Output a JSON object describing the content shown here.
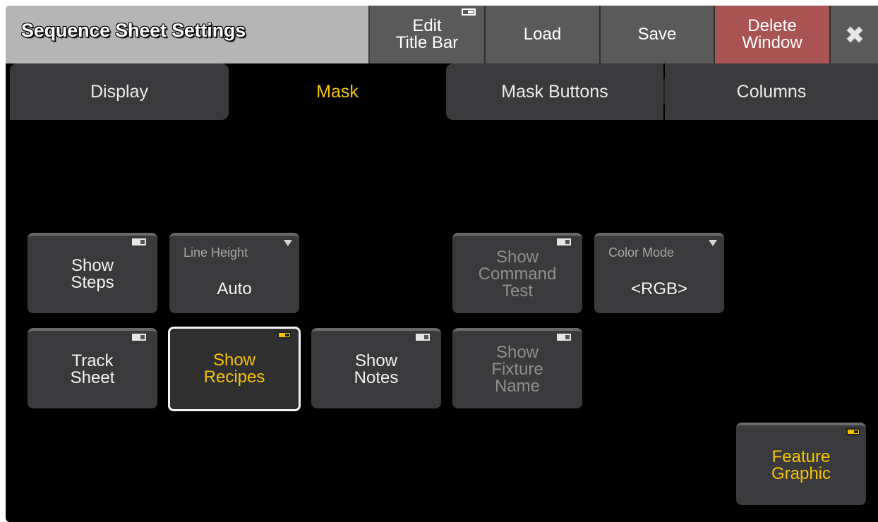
{
  "titlebar": {
    "title": "Sequence Sheet Settings",
    "edit_title_bar": "Edit\nTitle Bar",
    "load": "Load",
    "save": "Save",
    "delete_window": "Delete\nWindow",
    "close_icon": "close-icon"
  },
  "tabs": [
    {
      "label": "Display",
      "active": false
    },
    {
      "label": "Mask",
      "active": true
    },
    {
      "label": "Mask Buttons",
      "active": false
    },
    {
      "label": "Columns",
      "active": false
    }
  ],
  "buttons": {
    "show_steps": "Show\nSteps",
    "line_height_label": "Line Height",
    "line_height_value": "Auto",
    "show_command_test": "Show\nCommand\nTest",
    "color_mode_label": "Color Mode",
    "color_mode_value": "<RGB>",
    "track_sheet": "Track\nSheet",
    "show_recipes": "Show\nRecipes",
    "show_notes": "Show\nNotes",
    "show_fixture_name": "Show\nFixture\nName",
    "feature_graphic": "Feature\nGraphic"
  },
  "colors": {
    "accent": "#f5c400",
    "delete": "#a95452",
    "button_bg": "#3a3a3d"
  }
}
